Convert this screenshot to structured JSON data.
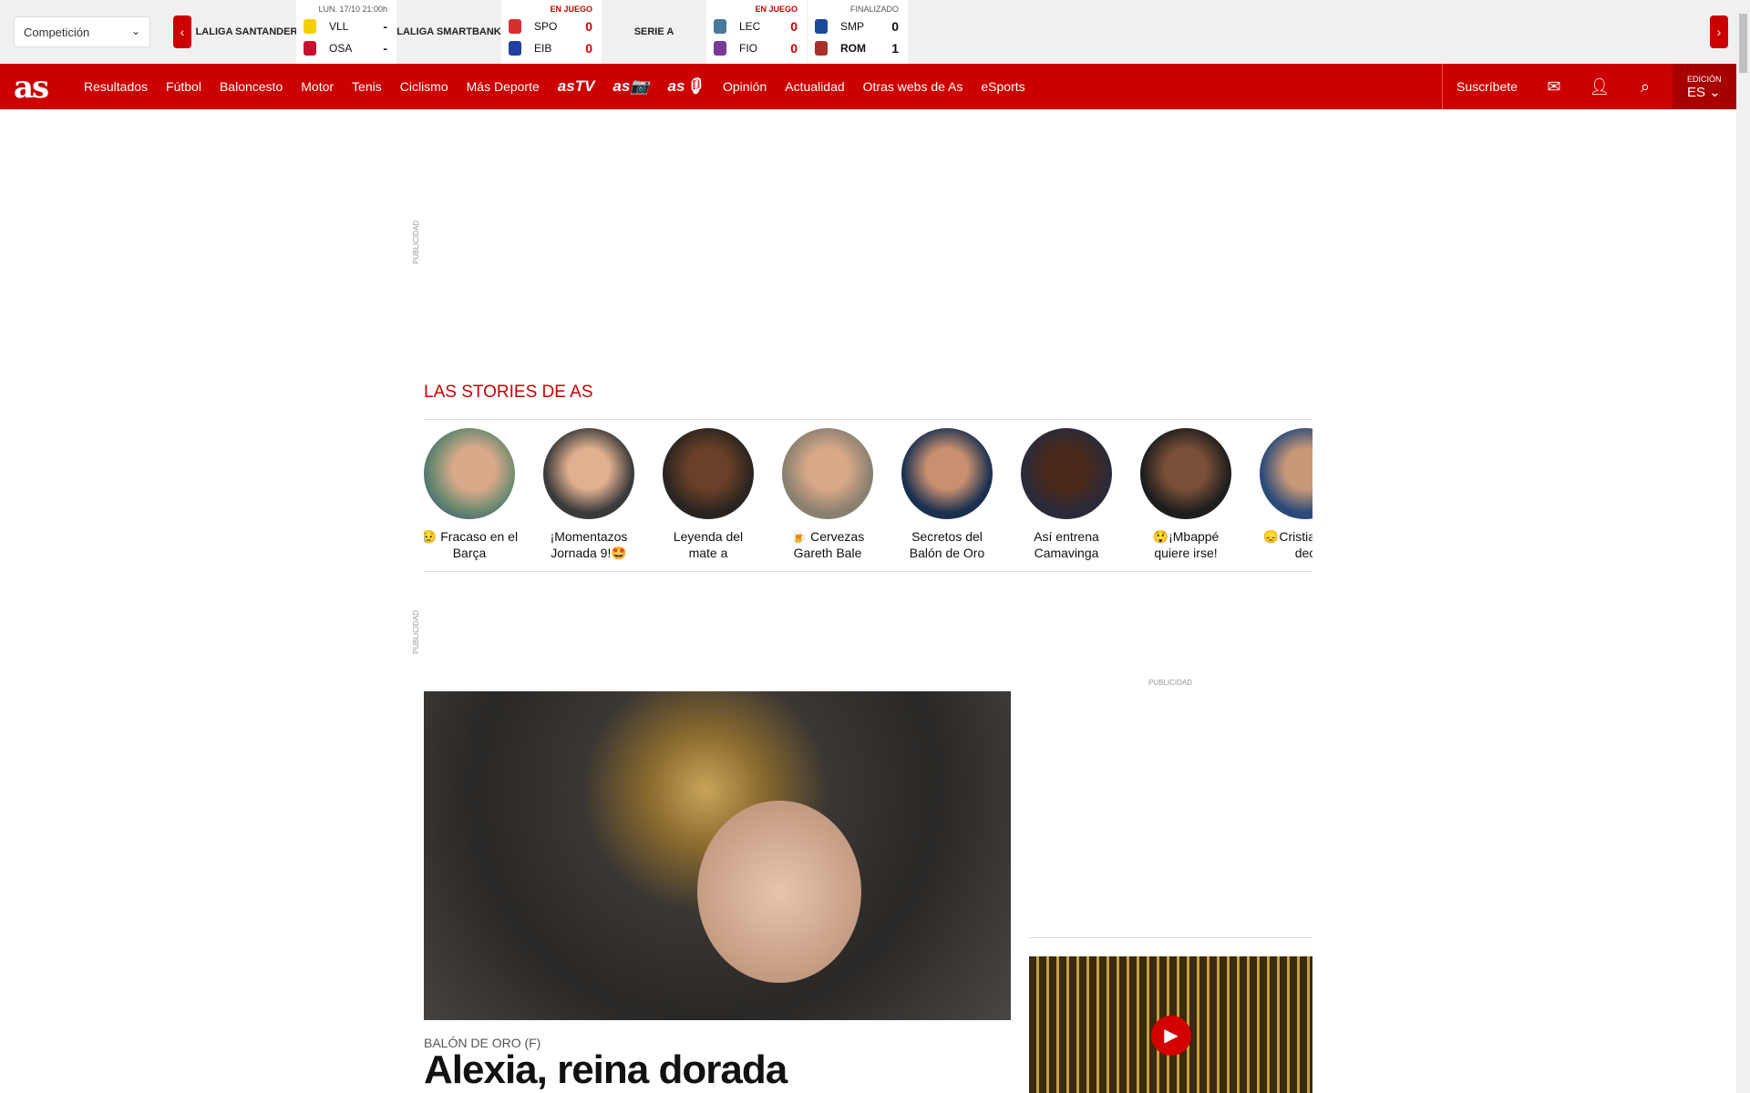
{
  "topbar": {
    "competition_select": "Competición",
    "competitions": [
      "LALIGA SANTANDER",
      "LALIGA SMARTBANK",
      "SERIE A"
    ],
    "matches": [
      {
        "status": "LUN. 17/10 21:00h",
        "home": "VLL",
        "away": "OSA",
        "home_score": "-",
        "away_score": "-"
      },
      {
        "status": "EN JUEGO",
        "home": "SPO",
        "away": "EIB",
        "home_score": "0",
        "away_score": "0"
      },
      {
        "status": "EN JUEGO",
        "home": "LEC",
        "away": "FIO",
        "home_score": "0",
        "away_score": "0"
      },
      {
        "status": "FINALIZADO",
        "home": "SMP",
        "away": "ROM",
        "home_score": "0",
        "away_score": "1"
      }
    ]
  },
  "nav": {
    "logo": "as",
    "items": [
      "Resultados",
      "Fútbol",
      "Baloncesto",
      "Motor",
      "Tenis",
      "Ciclismo",
      "Más Deporte"
    ],
    "brands": [
      "asTV",
      "as📷",
      "as🎙"
    ],
    "items2": [
      "Opinión",
      "Actualidad",
      "Otras webs de As",
      "eSports"
    ],
    "subscribe": "Suscríbete",
    "edition_label": "EDICIÓN",
    "edition": "ES ⌄"
  },
  "ads": {
    "label": "PUBLICIDAD"
  },
  "stories": {
    "title": "LAS STORIES DE AS",
    "items": [
      "😥 Fracaso en el Barça",
      "¡Momentazos Jornada 9!🤩",
      "Leyenda del mate a",
      "🍺 Cervezas Gareth Bale",
      "Secretos del Balón de Oro",
      "Así entrena Camavinga",
      "😲¡Mbappé quiere irse!",
      "😞Cristiano en dec"
    ]
  },
  "article": {
    "kicker": "BALÓN DE ORO (F)",
    "headline": "Alexia, reina dorada"
  },
  "colors": {
    "brand": "#cc0000"
  }
}
